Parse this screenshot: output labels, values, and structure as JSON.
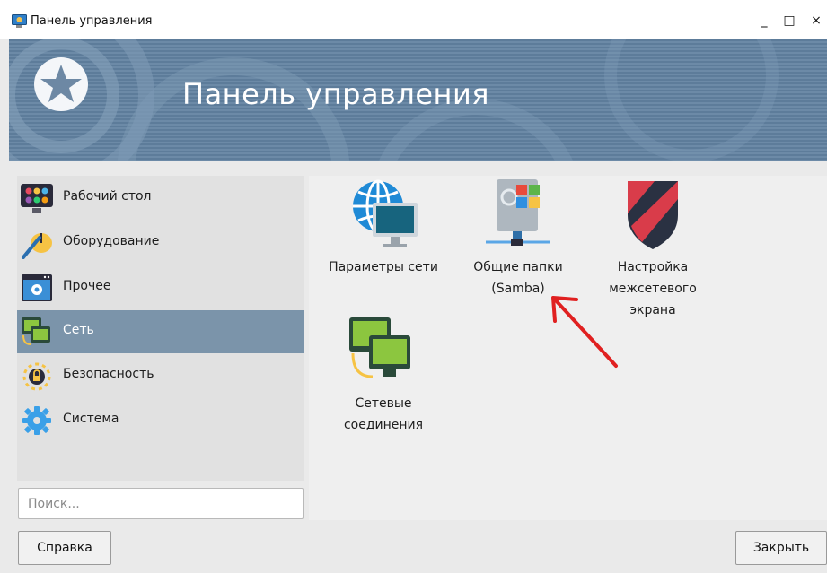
{
  "window": {
    "title": "Панель управления",
    "controls": {
      "minimize": "_",
      "maximize": "□",
      "close": "×"
    }
  },
  "banner": {
    "title": "Панель управления"
  },
  "sidebar": {
    "categories": [
      {
        "label": "Рабочий стол",
        "icon": "desktop-icon",
        "active": false
      },
      {
        "label": "Оборудование",
        "icon": "hardware-icon",
        "active": false
      },
      {
        "label": "Прочее",
        "icon": "misc-icon",
        "active": false
      },
      {
        "label": "Сеть",
        "icon": "network-icon",
        "active": true
      },
      {
        "label": "Безопасность",
        "icon": "security-icon",
        "active": false
      },
      {
        "label": "Система",
        "icon": "system-gear-icon",
        "active": false
      }
    ]
  },
  "search": {
    "placeholder": "Поиск...",
    "value": ""
  },
  "content": {
    "items": [
      {
        "label": "Параметры сети",
        "icon": "network-settings-icon"
      },
      {
        "label": "Общие папки\n(Samba)",
        "icon": "samba-shares-icon"
      },
      {
        "label": "Настройка\nмежсетевого\nэкрана",
        "icon": "firewall-icon"
      },
      {
        "label": "Сетевые\nсоединения",
        "icon": "network-connections-icon"
      }
    ]
  },
  "buttons": {
    "help": "Справка",
    "close": "Закрыть"
  },
  "colors": {
    "banner": "#6c8aa7",
    "active_category": "#7b94aa",
    "annotation_arrow": "#e02020"
  }
}
